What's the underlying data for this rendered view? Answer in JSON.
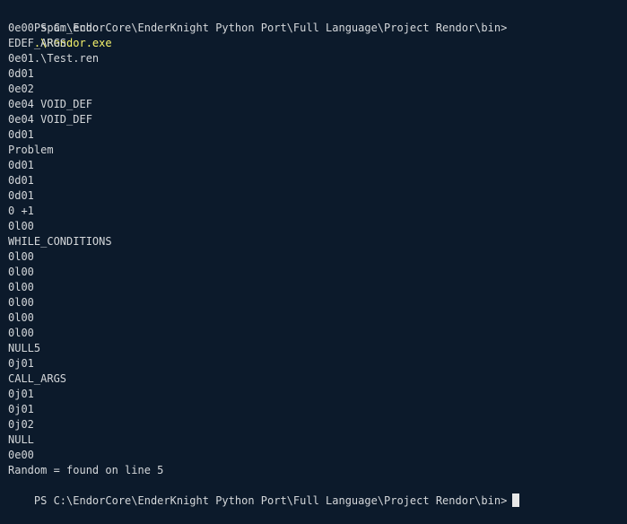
{
  "terminal": {
    "prompt": "PS C:\\EndorCore\\EnderKnight Python Port\\Full Language\\Project Rendor\\bin>",
    "command_exe": ".\\Rendor.exe",
    "command_args": ".\\Test.ren",
    "output_lines": [
      "0e00 spam_echo",
      "EDEF_ARGS",
      "0e01",
      "0d01",
      "0e02",
      "0e04 VOID_DEF",
      "0e04 VOID_DEF",
      "0d01",
      "Problem",
      "0d01",
      "0d01",
      "0d01",
      "0 +1",
      "0l00",
      "WHILE_CONDITIONS",
      "0l00",
      "0l00",
      "0l00",
      "0l00",
      "0l00",
      "0l00",
      "NULL5",
      "0j01",
      "CALL_ARGS",
      "0j01",
      "0j01",
      "0j02",
      "NULL",
      "0e00",
      "Random = found on line 5"
    ],
    "final_prompt": "PS C:\\EndorCore\\EnderKnight Python Port\\Full Language\\Project Rendor\\bin>"
  },
  "colors": {
    "background": "#0c1a2b",
    "text": "#d4d7da",
    "command_highlight": "#f7f36b",
    "cursor": "#e8e8e8"
  }
}
